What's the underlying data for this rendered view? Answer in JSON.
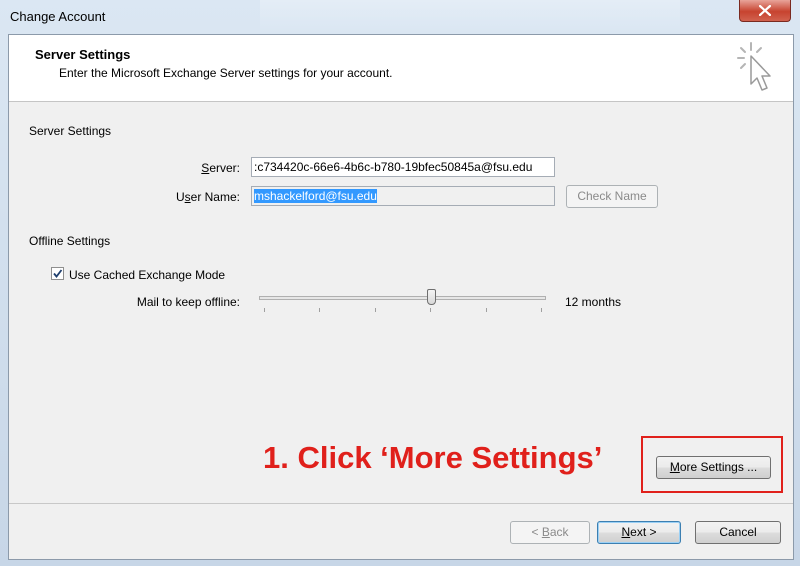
{
  "window": {
    "title": "Change Account"
  },
  "header": {
    "title": "Server Settings",
    "subtitle": "Enter the Microsoft Exchange Server settings for your account."
  },
  "server_settings": {
    "group_label": "Server Settings",
    "server_label": "Server:",
    "server_value": ":c734420c-66e6-4b6c-b780-19bfec50845a@fsu.edu",
    "username_label": "User Name:",
    "username_value": "mshackelford@fsu.edu",
    "check_name_label": "Check Name"
  },
  "offline_settings": {
    "group_label": "Offline Settings",
    "cached_mode_label": "Use Cached Exchange Mode",
    "cached_mode_checked": true,
    "mail_offline_label": "Mail to keep offline:",
    "mail_offline_value": "12 months",
    "slider_level": 0.6
  },
  "annotation": {
    "text": "1. Click ‘More Settings’",
    "color": "#e0201b"
  },
  "buttons": {
    "more_settings": "More Settings ...",
    "back": "< Back",
    "next": "Next >",
    "cancel": "Cancel"
  }
}
